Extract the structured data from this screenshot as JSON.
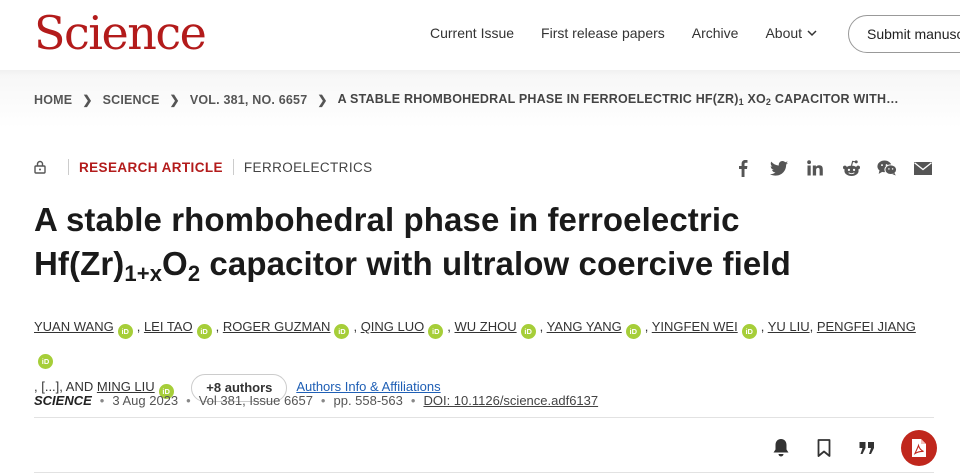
{
  "header": {
    "logo": "Science",
    "nav": [
      "Current Issue",
      "First release papers",
      "Archive",
      "About"
    ],
    "submit_label": "Submit manuscript"
  },
  "breadcrumb": {
    "home": "HOME",
    "journal": "SCIENCE",
    "volume": "VOL. 381, NO. 6657",
    "current_a": "A STABLE RHOMBOHEDRAL PHASE IN FERROELECTRIC HF(ZR)",
    "current_sub": "1",
    "current_b": " XO",
    "current_sub2": "2",
    "current_c": " CAPACITOR WITH…"
  },
  "meta": {
    "article_type": "RESEARCH ARTICLE",
    "subject": "FERROELECTRICS"
  },
  "share_icons": [
    "facebook-icon",
    "twitter-icon",
    "linkedin-icon",
    "reddit-icon",
    "wechat-icon",
    "email-icon"
  ],
  "title": {
    "line1": "A stable rhombohedral phase in ferroelectric",
    "l2_a": "Hf(Zr)",
    "l2_sub": "1+x",
    "l2_b": "O",
    "l2_sub2": "2",
    "l2_c": " capacitor with ultralow coercive field"
  },
  "authors": {
    "list": [
      "YUAN WANG",
      "LEI TAO",
      "ROGER GUZMAN",
      "QING LUO",
      "WU ZHOU",
      "YANG YANG",
      "YINGFEN WEI",
      "YU LIU",
      "PENGFEI JIANG"
    ],
    "ellipsis": ", [...], AND",
    "last": "MING LIU",
    "orcid_label": "iD",
    "more_label": "+8 authors",
    "affil_label": "Authors Info & Affiliations"
  },
  "citation": {
    "journal": "SCIENCE",
    "date": "3 Aug 2023",
    "volume": "Vol 381, Issue 6657",
    "pages": "pp. 558-563",
    "doi": "DOI: 10.1126/science.adf6137"
  },
  "colors": {
    "brand": "#b31b1b",
    "orcid": "#a6ce39",
    "link": "#1f5fb5",
    "pdf": "#c0271d"
  }
}
